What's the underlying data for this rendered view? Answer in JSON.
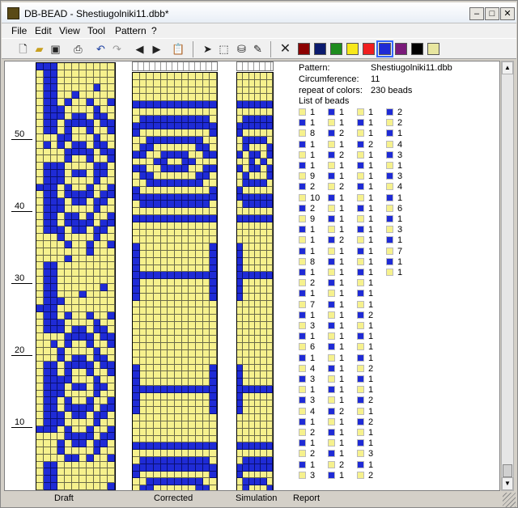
{
  "window": {
    "title": "DB-BEAD - Shestiugolniki11.dbb*",
    "min": "–",
    "max": "□",
    "close": "✕"
  },
  "menu": {
    "items": [
      "File",
      "Edit",
      "View",
      "Tool",
      "Pattern",
      "?"
    ]
  },
  "toolbar": {
    "icons": [
      "new-file-icon",
      "open-folder-icon",
      "save-icon",
      "print-icon",
      "undo-icon",
      "redo-icon",
      "arrow-left-icon",
      "arrow-right-icon",
      "clipboard-icon",
      "pointer-icon",
      "select-rect-icon",
      "fill-bucket-icon",
      "eyedropper-icon"
    ],
    "clear_icon": "✕",
    "palette": [
      "#8b0000",
      "#0a1a6e",
      "#1e8c1e",
      "#f8e81a",
      "#f01e1e",
      "#1f2bd6",
      "#7a1a7a",
      "#000000",
      "#e8e6a0"
    ],
    "selected_color_index": 5
  },
  "ruler": {
    "labels": [
      "50",
      "40",
      "30",
      "20",
      "10"
    ]
  },
  "colors": {
    "yellow": "#f6f18d",
    "blue": "#1f2bd6"
  },
  "grids": {
    "draft_cols": 11,
    "corrected_cols": 12,
    "simulation_cols": 6
  },
  "report": {
    "pattern_label": "Pattern:",
    "pattern_value": "Shestiugolniki11.dbb",
    "circumference_label": "Circumference:",
    "circumference_value": "11",
    "repeat_label": "repeat of colors:",
    "repeat_value": "230 beads",
    "list_label": "List of beads",
    "beads_col1": [
      [
        "y",
        "1"
      ],
      [
        "b",
        "1"
      ],
      [
        "y",
        "8"
      ],
      [
        "b",
        "1"
      ],
      [
        "y",
        "1"
      ],
      [
        "b",
        "1"
      ],
      [
        "y",
        "9"
      ],
      [
        "b",
        "2"
      ],
      [
        "y",
        "10"
      ],
      [
        "b",
        "2"
      ],
      [
        "y",
        "9"
      ],
      [
        "b",
        "1"
      ],
      [
        "y",
        "1"
      ],
      [
        "b",
        "1"
      ],
      [
        "y",
        "8"
      ],
      [
        "b",
        "1"
      ],
      [
        "y",
        "2"
      ],
      [
        "b",
        "1"
      ],
      [
        "y",
        "7"
      ],
      [
        "b",
        "1"
      ],
      [
        "y",
        "3"
      ],
      [
        "b",
        "1"
      ],
      [
        "y",
        "6"
      ],
      [
        "b",
        "1"
      ],
      [
        "y",
        "4"
      ],
      [
        "b",
        "3"
      ],
      [
        "y",
        "1"
      ],
      [
        "b",
        "3"
      ],
      [
        "y",
        "4"
      ],
      [
        "b",
        "1"
      ],
      [
        "y",
        "2"
      ],
      [
        "b",
        "1"
      ],
      [
        "y",
        "2"
      ],
      [
        "b",
        "1"
      ],
      [
        "y",
        "3"
      ]
    ],
    "beads_col2": [
      [
        "b",
        "1"
      ],
      [
        "y",
        "1"
      ],
      [
        "b",
        "2"
      ],
      [
        "y",
        "1"
      ],
      [
        "b",
        "2"
      ],
      [
        "y",
        "1"
      ],
      [
        "b",
        "1"
      ],
      [
        "y",
        "2"
      ],
      [
        "b",
        "1"
      ],
      [
        "y",
        "1"
      ],
      [
        "b",
        "1"
      ],
      [
        "y",
        "1"
      ],
      [
        "b",
        "2"
      ],
      [
        "y",
        "1"
      ],
      [
        "b",
        "1"
      ],
      [
        "y",
        "1"
      ],
      [
        "b",
        "1"
      ],
      [
        "y",
        "1"
      ],
      [
        "b",
        "1"
      ],
      [
        "y",
        "1"
      ],
      [
        "b",
        "1"
      ],
      [
        "y",
        "1"
      ],
      [
        "b",
        "1"
      ],
      [
        "y",
        "1"
      ],
      [
        "b",
        "1"
      ],
      [
        "y",
        "1"
      ],
      [
        "b",
        "1"
      ],
      [
        "y",
        "1"
      ],
      [
        "b",
        "2"
      ],
      [
        "y",
        "1"
      ],
      [
        "b",
        "1"
      ],
      [
        "y",
        "1"
      ],
      [
        "b",
        "1"
      ],
      [
        "y",
        "2"
      ],
      [
        "b",
        "1"
      ]
    ],
    "beads_col3": [
      [
        "y",
        "1"
      ],
      [
        "b",
        "1"
      ],
      [
        "y",
        "1"
      ],
      [
        "b",
        "2"
      ],
      [
        "y",
        "1"
      ],
      [
        "b",
        "1"
      ],
      [
        "y",
        "1"
      ],
      [
        "b",
        "1"
      ],
      [
        "y",
        "1"
      ],
      [
        "b",
        "1"
      ],
      [
        "y",
        "1"
      ],
      [
        "b",
        "1"
      ],
      [
        "y",
        "1"
      ],
      [
        "b",
        "1"
      ],
      [
        "y",
        "1"
      ],
      [
        "b",
        "1"
      ],
      [
        "y",
        "1"
      ],
      [
        "b",
        "1"
      ],
      [
        "y",
        "1"
      ],
      [
        "b",
        "2"
      ],
      [
        "y",
        "1"
      ],
      [
        "b",
        "1"
      ],
      [
        "y",
        "1"
      ],
      [
        "b",
        "1"
      ],
      [
        "y",
        "2"
      ],
      [
        "b",
        "1"
      ],
      [
        "y",
        "1"
      ],
      [
        "b",
        "2"
      ],
      [
        "y",
        "1"
      ],
      [
        "b",
        "2"
      ],
      [
        "y",
        "1"
      ],
      [
        "b",
        "1"
      ],
      [
        "y",
        "3"
      ],
      [
        "b",
        "1"
      ],
      [
        "y",
        "2"
      ]
    ],
    "beads_col4": [
      [
        "b",
        "2"
      ],
      [
        "y",
        "2"
      ],
      [
        "b",
        "1"
      ],
      [
        "y",
        "4"
      ],
      [
        "b",
        "3"
      ],
      [
        "y",
        "1"
      ],
      [
        "b",
        "3"
      ],
      [
        "y",
        "4"
      ],
      [
        "b",
        "1"
      ],
      [
        "y",
        "6"
      ],
      [
        "b",
        "1"
      ],
      [
        "y",
        "3"
      ],
      [
        "b",
        "1"
      ],
      [
        "y",
        "7"
      ],
      [
        "b",
        "1"
      ],
      [
        "y",
        "1"
      ]
    ]
  },
  "tabs": [
    "Draft",
    "Corrected",
    "Simulation",
    "Report"
  ]
}
